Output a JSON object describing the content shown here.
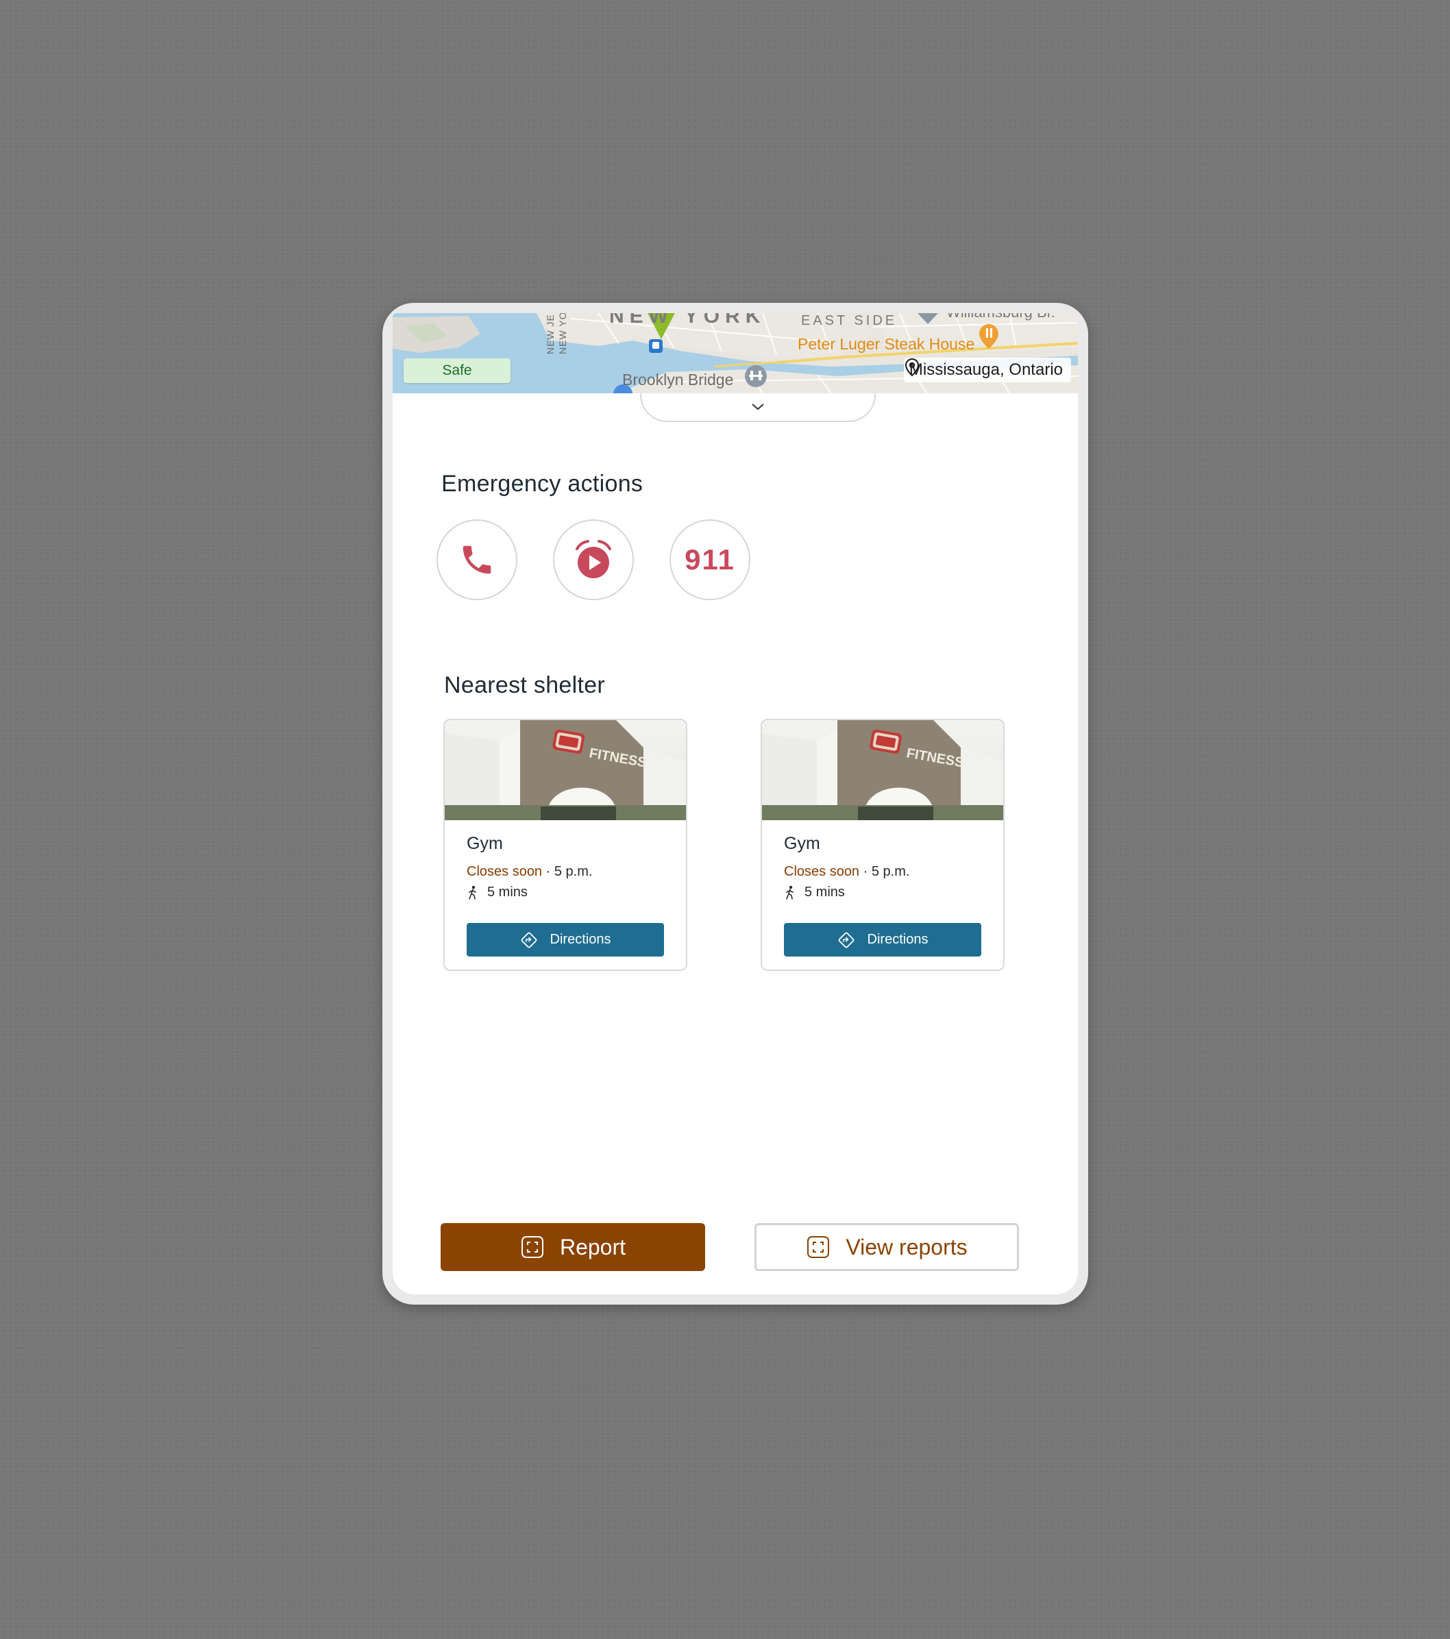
{
  "map": {
    "safety_status": "Safe",
    "location": "Mississauga, Ontario",
    "labels": {
      "area": "NEW YORK",
      "east_side": "EAST SIDE",
      "williamsburg": "Williamsburg Br.",
      "restaurant": "Peter Luger Steak House",
      "bridge": "Brooklyn Bridge",
      "state_border_1": "NEW JERSEY",
      "state_border_2": "NEW YORK"
    },
    "pin_icon": "location-pin-icon",
    "expand_icon": "chevron-down-icon"
  },
  "emergency": {
    "title": "Emergency actions",
    "actions": [
      {
        "icon": "phone-icon"
      },
      {
        "icon": "alarm-timer-icon"
      },
      {
        "label": "911"
      }
    ],
    "accent_color": "#c8495c"
  },
  "shelter": {
    "title": "Nearest shelter",
    "cards": [
      {
        "name": "Gym",
        "status": "Closes soon",
        "separator": "·",
        "closing_time": "5 p.m.",
        "walk_time": "5 mins",
        "directions_label": "Directions",
        "photo_sign": "FITNESS"
      },
      {
        "name": "Gym",
        "status": "Closes soon",
        "separator": "·",
        "closing_time": "5 p.m.",
        "walk_time": "5 mins",
        "directions_label": "Directions",
        "photo_sign": "FITNESS"
      }
    ],
    "button_color": "#1f6e91"
  },
  "footer": {
    "report_label": "Report",
    "view_reports_label": "View reports",
    "primary_color": "#8b4300"
  }
}
